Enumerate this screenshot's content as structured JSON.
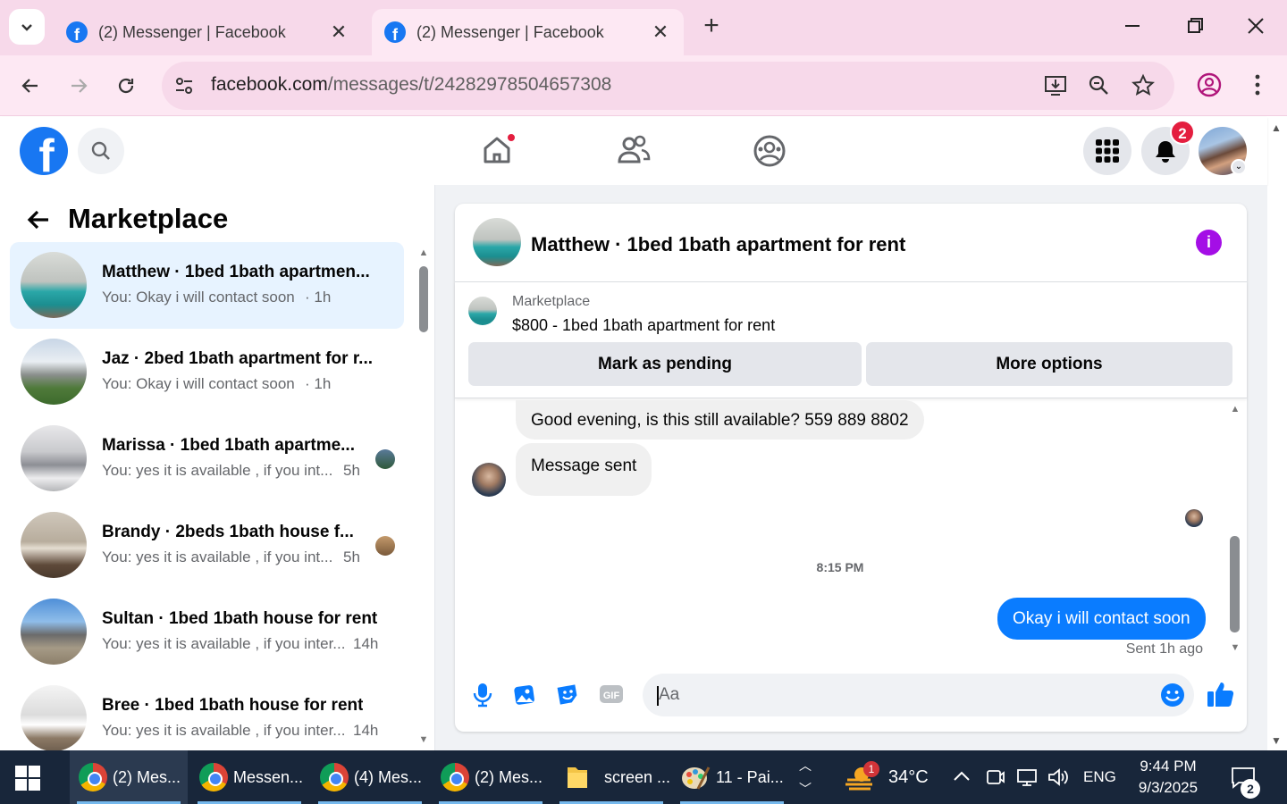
{
  "browser": {
    "tabs": [
      {
        "title": "(2) Messenger | Facebook",
        "active": false
      },
      {
        "title": "(2) Messenger | Facebook",
        "active": true
      }
    ],
    "url_host": "facebook.com",
    "url_path": "/messages/t/24282978504657308"
  },
  "fb_header": {
    "notification_count": "2"
  },
  "sidebar": {
    "title": "Marketplace",
    "conversations": [
      {
        "name": "Matthew · 1bed 1bath apartmen...",
        "preview": "You: Okay i will contact soon",
        "time": "· 1h",
        "selected": true
      },
      {
        "name": "Jaz · 2bed 1bath apartment for r...",
        "preview": "You: Okay i will contact soon",
        "time": "· 1h"
      },
      {
        "name": "Marissa · 1bed 1bath apartme...",
        "preview": "You: yes it is available , if you int...",
        "time": "5h"
      },
      {
        "name": "Brandy · 2beds 1bath house f...",
        "preview": "You: yes it is available , if you int...",
        "time": "5h"
      },
      {
        "name": "Sultan · 1bed 1bath house for rent",
        "preview": "You: yes it is available , if you inter...",
        "time": "14h"
      },
      {
        "name": "Bree · 1bed 1bath house for rent",
        "preview": "You: yes it is available , if you inter...",
        "time": "14h"
      }
    ]
  },
  "chat": {
    "title": "Matthew · 1bed 1bath apartment for rent",
    "listing_source": "Marketplace",
    "listing_title": "$800 - 1bed 1bath apartment for rent",
    "mark_pending_label": "Mark as pending",
    "more_options_label": "More options",
    "messages": [
      {
        "text": "Good evening, is this still available? 559 889 8802",
        "direction": "in"
      },
      {
        "text": "Message sent",
        "direction": "in"
      }
    ],
    "timestamp": "8:15 PM",
    "outgoing_message": "Okay i will contact soon",
    "sent_status": "Sent 1h ago",
    "composer_placeholder": "Aa"
  },
  "taskbar": {
    "items": [
      {
        "label": "(2) Mes...",
        "icon": "chrome-icon",
        "active": true
      },
      {
        "label": "Messen...",
        "icon": "chrome-icon"
      },
      {
        "label": "(4) Mes...",
        "icon": "chrome-icon"
      },
      {
        "label": "(2) Mes...",
        "icon": "chrome-icon"
      },
      {
        "label": "screen ...",
        "icon": "folder-icon"
      },
      {
        "label": "11 - Pai...",
        "icon": "paint-icon"
      }
    ],
    "weather_badge": "1",
    "temperature": "34°C",
    "language": "ENG",
    "time": "9:44 PM",
    "date": "9/3/2025",
    "notification_count": "2"
  },
  "colors": {
    "accent_blue": "#0a7cff",
    "facebook_blue": "#1877f2",
    "messenger_purple": "#a40ee6",
    "notification_red": "#e41e3f",
    "chrome_tab_bg": "#f7d9ea"
  }
}
